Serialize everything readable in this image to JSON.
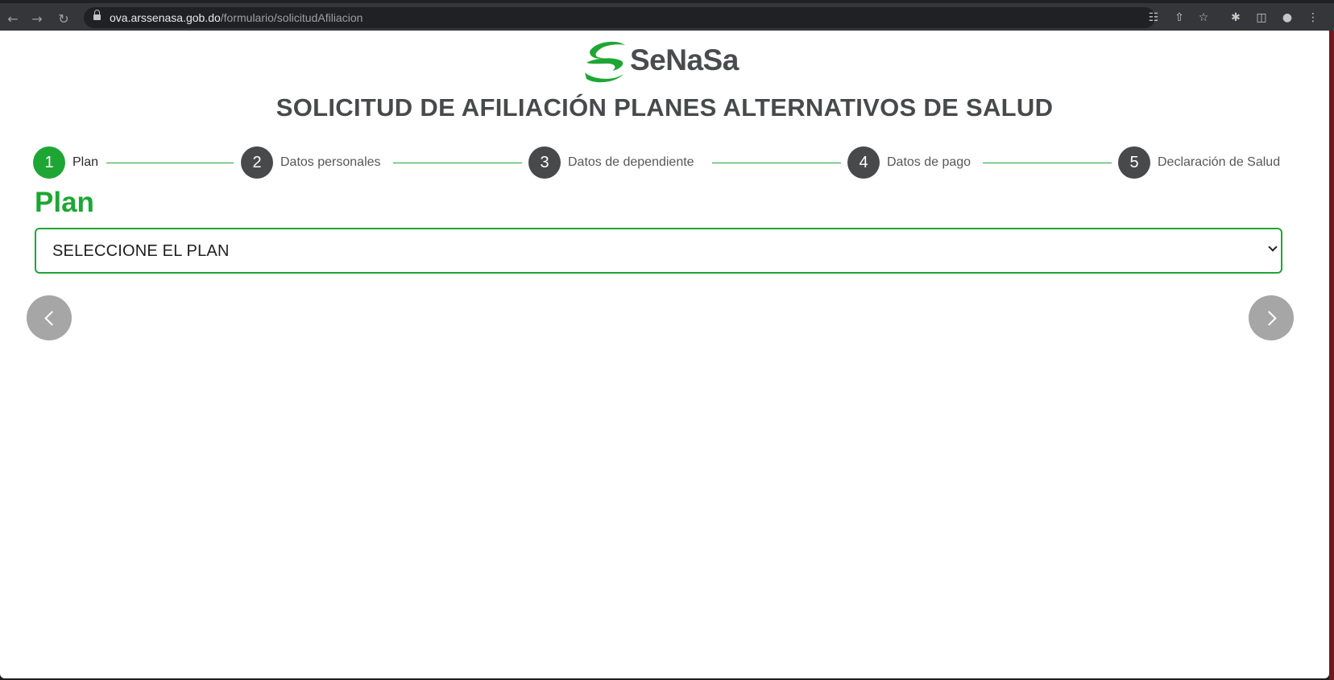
{
  "browser": {
    "url_host": "ova.arssenasa.gob.do",
    "url_path": "/formulario/solicitudAfiliacion"
  },
  "logo": {
    "text": "SeNaSa",
    "colors": {
      "green": "#1ea634",
      "gray": "#4a4b4d"
    }
  },
  "header": {
    "title": "SOLICITUD DE AFILIACIÓN PLANES ALTERNATIVOS DE SALUD"
  },
  "stepper": {
    "steps": [
      {
        "number": "1",
        "label": "Plan",
        "active": true
      },
      {
        "number": "2",
        "label": "Datos personales",
        "active": false
      },
      {
        "number": "3",
        "label": "Datos de dependiente",
        "active": false
      },
      {
        "number": "4",
        "label": "Datos de pago",
        "active": false
      },
      {
        "number": "5",
        "label": "Declaración de Salud",
        "active": false
      }
    ]
  },
  "form": {
    "section_title": "Plan",
    "plan_select": {
      "selected": "SELECCIONE EL PLAN"
    }
  },
  "navigation": {
    "prev_icon": "chevron-left-icon",
    "next_icon": "chevron-right-icon"
  },
  "colors": {
    "accent": "#1ea634",
    "step_inactive": "#48494b",
    "nav_button": "#a6a6a6"
  }
}
